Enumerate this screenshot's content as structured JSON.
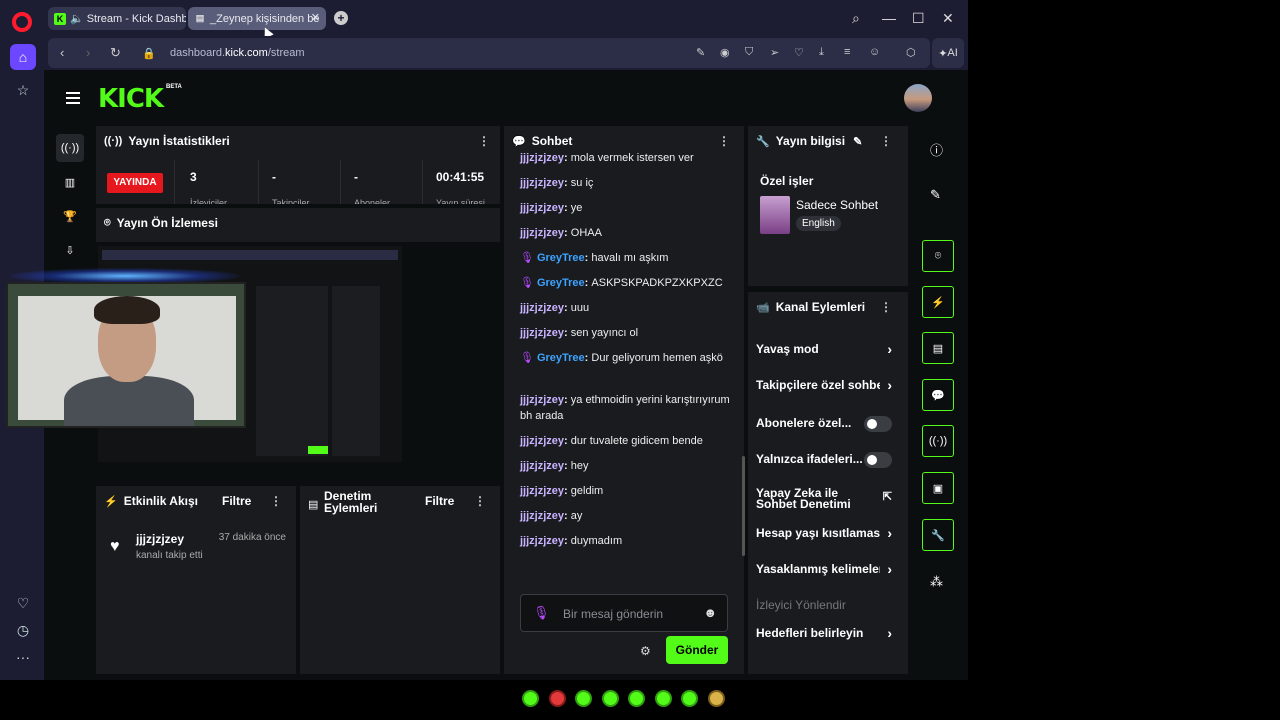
{
  "browser": {
    "tabs": [
      {
        "label": "Stream - Kick Dashboa",
        "favicon": "K"
      },
      {
        "label": "_Zeynep kişisinden be",
        "favicon": "▤"
      }
    ],
    "url_prefix": "dashboard.",
    "url_domain": "kick.com",
    "url_path": "/stream",
    "ai_label": "AI"
  },
  "header": {
    "logo": "KICK",
    "beta": "BETA"
  },
  "stats": {
    "title": "Yayın İstatistikleri",
    "live": "YAYINDA",
    "viewers": "3",
    "viewers_label": "İzleyiciler",
    "followers": "-",
    "followers_label": "Takipçiler",
    "subs": "-",
    "subs_label": "Aboneler",
    "duration": "00:41:55",
    "duration_label": "Yayın süresi"
  },
  "preview": {
    "title": "Yayın Ön İzlemesi"
  },
  "activity": {
    "title": "Etkinlik Akışı",
    "filter": "Filtre",
    "item_user": "jjjzjzjzey",
    "item_text": "kanalı takip etti",
    "item_time": "37 dakika önce"
  },
  "moderation": {
    "title_line1": "Denetim",
    "title_line2": "Eylemleri",
    "filter": "Filtre"
  },
  "chat": {
    "title": "Sohbet",
    "messages": [
      {
        "user": "jjjzjzjzey",
        "text": "mola vermek istersen ver",
        "mod": false
      },
      {
        "user": "jjjzjzjzey",
        "text": "su iç",
        "mod": false
      },
      {
        "user": "jjjzjzjzey",
        "text": "ye",
        "mod": false
      },
      {
        "user": "jjjzjzjzey",
        "text": "OHAA",
        "mod": false
      },
      {
        "user": "GreyTree",
        "text": "havalı mı aşkım",
        "mod": true
      },
      {
        "user": "GreyTree",
        "text": "ASKPSKPADKPZXKPXZC",
        "mod": true
      },
      {
        "user": "jjjzjzjzey",
        "text": "uuu",
        "mod": false
      },
      {
        "user": "jjjzjzjzey",
        "text": "sen yayıncı ol",
        "mod": false
      },
      {
        "user": "GreyTree",
        "text": "Dur geliyorum hemen aşkö",
        "mod": true
      },
      {
        "user": "jjjzjzjzey",
        "text": "ya ethmoidin yerini karıştırıyırum bh arada",
        "mod": false
      },
      {
        "user": "jjjzjzjzey",
        "text": "dur tuvalete gidicem bende",
        "mod": false
      },
      {
        "user": "jjjzjzjzey",
        "text": "hey",
        "mod": false
      },
      {
        "user": "jjjzjzjzey",
        "text": "geldim",
        "mod": false
      },
      {
        "user": "jjjzjzjzey",
        "text": "ay",
        "mod": false
      },
      {
        "user": "jjjzjzjzey",
        "text": "duymadım",
        "mod": false
      }
    ],
    "placeholder": "Bir mesaj gönderin",
    "send": "Gönder"
  },
  "info": {
    "title": "Yayın bilgisi",
    "section": "Özel işler",
    "category": "Sadece Sohbet",
    "language": "English"
  },
  "actions": {
    "title": "Kanal Eylemleri",
    "items": [
      {
        "label": "Yavaş mod",
        "kind": "chevron"
      },
      {
        "label": "Takipçilere özel sohbet",
        "kind": "chevron"
      },
      {
        "label": "Abonelere özel...",
        "kind": "toggle"
      },
      {
        "label": "Yalnızca ifadeleri...",
        "kind": "toggle"
      },
      {
        "label": "Yapay Zeka ile Sohbet Denetimi",
        "kind": "external"
      },
      {
        "label": "Hesap yaşı kısıtlaması",
        "kind": "chevron"
      },
      {
        "label": "Yasaklanmış kelimeler",
        "kind": "chevron"
      },
      {
        "label": "İzleyici Yönlendir",
        "kind": "disabled"
      },
      {
        "label": "Hedefleri belirleyin",
        "kind": "chevron"
      }
    ]
  },
  "colors": {
    "brand": "#53fc18",
    "live": "#e6171d",
    "mod_user": "#3da3ff",
    "user": "#c9b3ff"
  }
}
